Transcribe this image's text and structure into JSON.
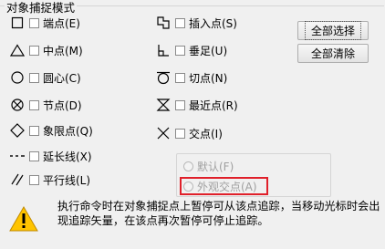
{
  "group": {
    "title": "对象捕捉模式"
  },
  "snaps_left": [
    {
      "label": "端点(E)",
      "icon": "endpoint-square-icon"
    },
    {
      "label": "中点(M)",
      "icon": "midpoint-triangle-icon"
    },
    {
      "label": "圆心(C)",
      "icon": "center-circle-icon"
    },
    {
      "label": "节点(D)",
      "icon": "node-icon"
    },
    {
      "label": "象限点(Q)",
      "icon": "quadrant-diamond-icon"
    },
    {
      "label": "延长线(X)",
      "icon": "extension-icon"
    },
    {
      "label": "平行线(L)",
      "icon": "parallel-icon"
    }
  ],
  "snaps_right": [
    {
      "label": "插入点(S)",
      "icon": "insertion-icon"
    },
    {
      "label": "垂足(U)",
      "icon": "perpendicular-icon"
    },
    {
      "label": "切点(N)",
      "icon": "tangent-icon"
    },
    {
      "label": "最近点(R)",
      "icon": "nearest-hourglass-icon"
    },
    {
      "label": "交点(I)",
      "icon": "intersection-x-icon"
    }
  ],
  "buttons": {
    "select_all": "全部选择",
    "clear_all": "全部清除"
  },
  "intersection_mode": {
    "options": [
      {
        "label": "默认(F)",
        "enabled": false
      },
      {
        "label": "外观交点(A)",
        "enabled": false
      }
    ]
  },
  "info": {
    "icon": "warning-icon",
    "text": "执行命令时在对象捕捉点上暂停可从该点追踪，当移动光标时会出现追踪矢量，在该点再次暂停可停止追踪。"
  }
}
